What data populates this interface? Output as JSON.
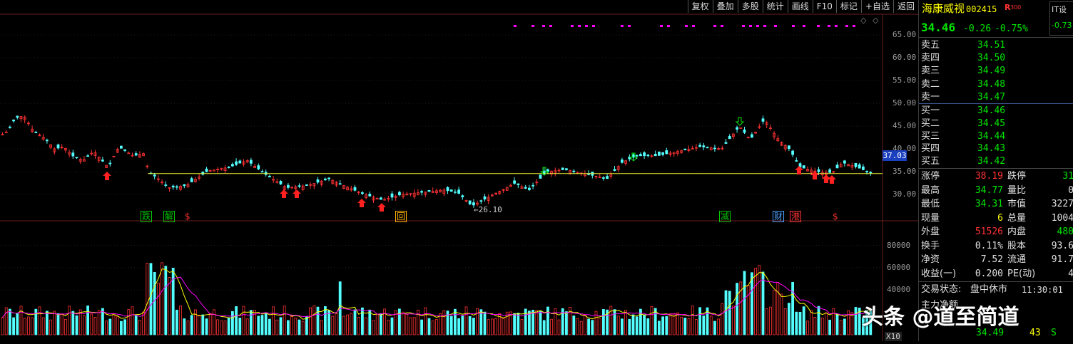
{
  "toolbar": {
    "items": [
      "复权",
      "叠加",
      "多股",
      "统计",
      "画线",
      "F10",
      "标记",
      "+自选",
      "返回"
    ]
  },
  "price_axis": {
    "labels": [
      "65.00",
      "60.00",
      "55.00",
      "50.00",
      "45.00",
      "40.00",
      "35.00",
      "30.00"
    ],
    "values": [
      65,
      60,
      55,
      50,
      45,
      40,
      35,
      30
    ],
    "min": 25.5,
    "max": 67.5,
    "current": "37.03",
    "support_level": 34.6
  },
  "low_annotation": "←26.10",
  "volume_axis": {
    "labels": [
      "80000",
      "60000",
      "40000"
    ],
    "values": [
      80000,
      60000,
      40000
    ],
    "multiplier": "X10",
    "max": 88000
  },
  "event_tags": [
    {
      "text": "跌",
      "color": "#00c800"
    },
    {
      "text": "解",
      "color": "#00c800"
    },
    {
      "text": "$",
      "color": "#ff3232"
    },
    {
      "text": "回",
      "color": "#ffb000"
    },
    {
      "text": "减",
      "color": "#00c800"
    },
    {
      "text": "财",
      "color": "#4aa0ff"
    },
    {
      "text": "港",
      "color": "#ff3232"
    },
    {
      "text": "$",
      "color": "#ff3232"
    }
  ],
  "stock": {
    "name": "海康威视",
    "code": "002415",
    "flag": "R",
    "flag_sub": "300",
    "related_label": "IT设",
    "related_change": "-0.73",
    "price": "34.46",
    "change": "-0.26",
    "change_pct": "-0.75%"
  },
  "asks": [
    {
      "label": "卖五",
      "price": "34.51"
    },
    {
      "label": "卖四",
      "price": "34.50"
    },
    {
      "label": "卖三",
      "price": "34.49"
    },
    {
      "label": "卖二",
      "price": "34.48"
    },
    {
      "label": "卖一",
      "price": "34.47"
    }
  ],
  "bids": [
    {
      "label": "买一",
      "price": "34.46"
    },
    {
      "label": "买二",
      "price": "34.45"
    },
    {
      "label": "买三",
      "price": "34.44"
    },
    {
      "label": "买四",
      "price": "34.43"
    },
    {
      "label": "买五",
      "price": "34.42"
    }
  ],
  "stats": [
    {
      "l1": "涨停",
      "v1": "38.19",
      "c1": "red",
      "l2": "跌停",
      "v2": "31",
      "c2": "green"
    },
    {
      "l1": "最高",
      "v1": "34.77",
      "c1": "green",
      "l2": "量比",
      "v2": "0",
      "c2": "white"
    },
    {
      "l1": "最低",
      "v1": "34.31",
      "c1": "green",
      "l2": "市值",
      "v2": "3227",
      "c2": "white"
    },
    {
      "l1": "现量",
      "v1": "6",
      "c1": "yellow",
      "l2": "总量",
      "v2": "1004",
      "c2": "white"
    },
    {
      "l1": "外盘",
      "v1": "51526",
      "c1": "red",
      "l2": "内盘",
      "v2": "480",
      "c2": "green"
    },
    {
      "l1": "换手",
      "v1": "0.11%",
      "c1": "white",
      "l2": "股本",
      "v2": "93.6",
      "c2": "white"
    },
    {
      "l1": "净资",
      "v1": "7.52",
      "c1": "white",
      "l2": "流通",
      "v2": "91.7",
      "c2": "white"
    },
    {
      "l1": "收益(一)",
      "v1": "0.200",
      "c1": "white",
      "l2": "PE(动)",
      "v2": "4",
      "c2": "white"
    }
  ],
  "trade_status": {
    "label": "交易状态:",
    "value": "盘中休市",
    "time": "11:30:01"
  },
  "bottom": {
    "partial_label": "主力净额",
    "price": "34.49",
    "qty": "43",
    "side": "S"
  },
  "watermark": "头条 @道至简道",
  "colors": {
    "up": "#ff3232",
    "down": "#54ffff",
    "ma1": "#ffff00",
    "ma2": "#ff00ff",
    "support": "#e8e832",
    "bg": "#000000"
  }
}
